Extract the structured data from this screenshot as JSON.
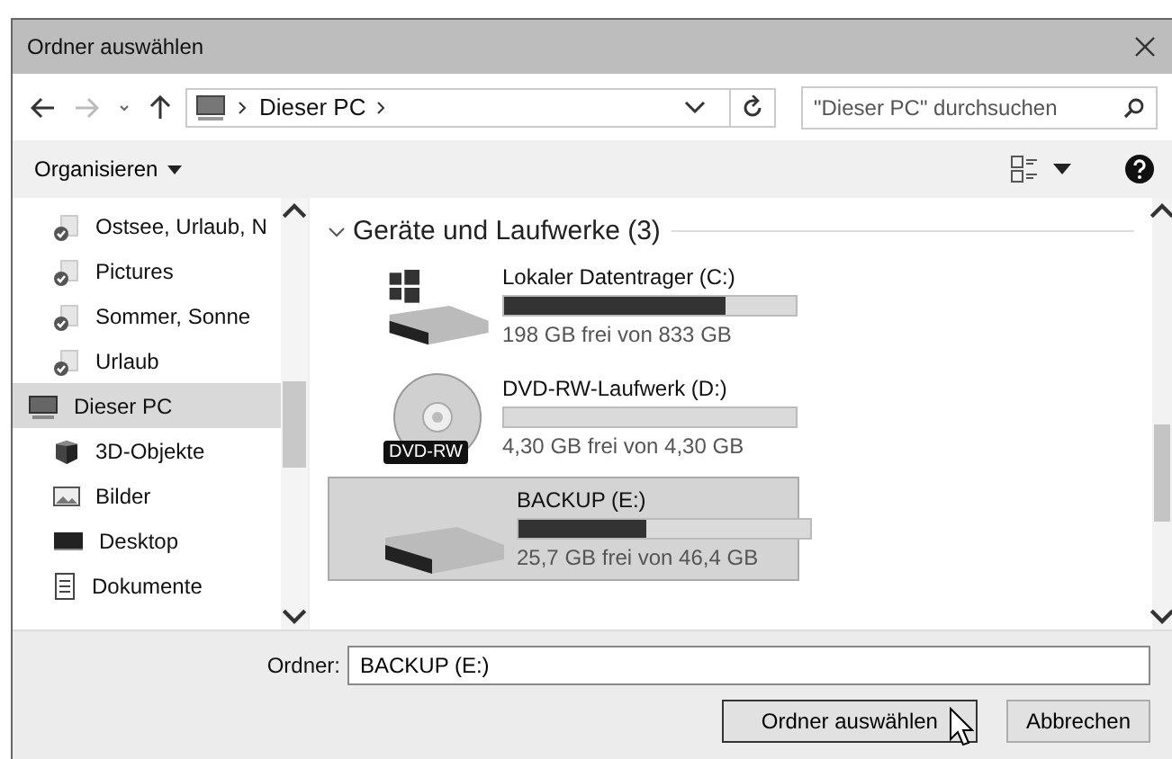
{
  "window": {
    "title": "Ordner auswählen"
  },
  "address": {
    "path": [
      "Dieser PC"
    ],
    "search_placeholder": "\"Dieser PC\" durchsuchen"
  },
  "toolbar": {
    "organize": "Organisieren"
  },
  "sidebar": {
    "items": [
      {
        "label": "Ostsee, Urlaub, N",
        "kind": "pinned",
        "selected": false
      },
      {
        "label": "Pictures",
        "kind": "pinned",
        "selected": false
      },
      {
        "label": "Sommer, Sonne",
        "kind": "pinned",
        "selected": false
      },
      {
        "label": "Urlaub",
        "kind": "pinned",
        "selected": false
      },
      {
        "label": "Dieser PC",
        "kind": "pc",
        "selected": true
      },
      {
        "label": "3D-Objekte",
        "kind": "cube",
        "selected": false
      },
      {
        "label": "Bilder",
        "kind": "pictures",
        "selected": false
      },
      {
        "label": "Desktop",
        "kind": "desktop",
        "selected": false
      },
      {
        "label": "Dokumente",
        "kind": "documents",
        "selected": false
      }
    ]
  },
  "content": {
    "group": {
      "title": "Geräte und Laufwerke (3)",
      "expanded": true
    },
    "drives": [
      {
        "name": "Lokaler Datentrager (C:)",
        "kind": "system",
        "level": 0.76,
        "free": "198 GB frei von 833 GB",
        "selected": false
      },
      {
        "name": "DVD-RW-Laufwerk (D:)",
        "kind": "dvd",
        "badge": "DVD-RW",
        "level": 0,
        "free": "4,30 GB frei von 4,30 GB",
        "selected": false
      },
      {
        "name": "BACKUP (E:)",
        "kind": "disk",
        "level": 0.44,
        "free": "25,7 GB frei von 46,4 GB",
        "selected": true
      }
    ]
  },
  "footer": {
    "folder_label": "Ordner:",
    "folder_value": "BACKUP (E:)",
    "buttons": [
      "Ordner auswählen",
      "Abbrechen"
    ]
  }
}
